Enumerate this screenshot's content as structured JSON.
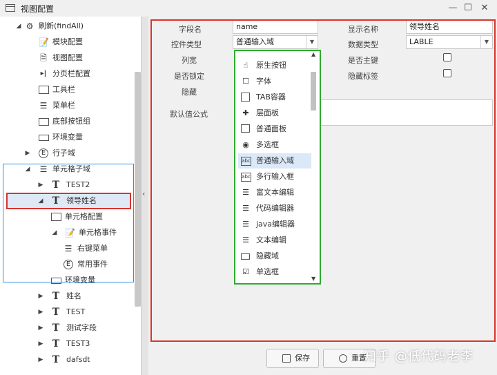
{
  "window": {
    "title": "视图配置",
    "controls": [
      "minimize",
      "maximize",
      "close"
    ]
  },
  "tree": {
    "items": [
      {
        "label": "刷新(findAll)",
        "icon": "gear-icon",
        "arrow": "▲"
      },
      {
        "label": "模块配置",
        "icon": "document-edit-icon"
      },
      {
        "label": "视图配置",
        "icon": "document-icon"
      },
      {
        "label": "分页栏配置",
        "icon": "pager-icon"
      },
      {
        "label": "工具栏",
        "icon": "toolbar-icon"
      },
      {
        "label": "菜单栏",
        "icon": "menu-icon"
      },
      {
        "label": "底部按钮组",
        "icon": "button-group-icon"
      },
      {
        "label": "环境变量",
        "icon": "env-icon"
      },
      {
        "label": "行子域",
        "icon": "event-icon",
        "arrow": "▶"
      },
      {
        "label": "单元格子域",
        "icon": "menu-icon",
        "arrow": "▲"
      },
      {
        "label": "TEST2",
        "icon": "text-field-icon",
        "arrow": "▶"
      },
      {
        "label": "领导姓名",
        "icon": "text-field-icon",
        "arrow": "◢"
      },
      {
        "label": "单元格配置",
        "icon": "window-icon"
      },
      {
        "label": "单元格事件",
        "icon": "document-edit-icon",
        "arrow": "◢"
      },
      {
        "label": "右键菜单",
        "icon": "menu-icon"
      },
      {
        "label": "常用事件",
        "icon": "event-icon"
      },
      {
        "label": "环境变量",
        "icon": "env-icon"
      },
      {
        "label": "姓名",
        "icon": "text-field-icon",
        "arrow": "▶"
      },
      {
        "label": "TEST",
        "icon": "text-field-icon",
        "arrow": "▶"
      },
      {
        "label": "测试字段",
        "icon": "text-field-icon",
        "arrow": "▶"
      },
      {
        "label": "TEST3",
        "icon": "text-field-icon",
        "arrow": "▶"
      },
      {
        "label": "dafsdt",
        "icon": "text-field-icon",
        "arrow": "▶"
      }
    ]
  },
  "form": {
    "field_name_label": "字段名",
    "field_name_value": "name",
    "display_name_label": "显示名称",
    "display_name_value": "领导姓名",
    "control_type_label": "控件类型",
    "control_type_value": "普通输入域",
    "data_type_label": "数据类型",
    "data_type_value": "LABLE",
    "column_width_label": "列宽",
    "is_pk_label": "是否主键",
    "is_locked_label": "是否锁定",
    "hide_label_label": "隐藏标签",
    "hidden_label": "隐藏",
    "default_formula_label": "默认值公式"
  },
  "dropdown": {
    "items": [
      {
        "label": "原生按钮",
        "icon": "hand-pointer-icon"
      },
      {
        "label": "字体",
        "icon": "checkbox-empty-icon"
      },
      {
        "label": "TAB容器",
        "icon": "tab-container-icon"
      },
      {
        "label": "层面板",
        "icon": "puzzle-icon"
      },
      {
        "label": "普通面板",
        "icon": "panel-icon"
      },
      {
        "label": "多选框",
        "icon": "radio-icon"
      },
      {
        "label": "普通输入域",
        "icon": "abc-icon",
        "selected": true
      },
      {
        "label": "多行输入框",
        "icon": "abc-icon"
      },
      {
        "label": "富文本编辑",
        "icon": "rich-text-icon"
      },
      {
        "label": "代码编辑器",
        "icon": "rich-text-icon"
      },
      {
        "label": "java编辑器",
        "icon": "rich-text-icon"
      },
      {
        "label": "文本编辑",
        "icon": "rich-text-icon"
      },
      {
        "label": "隐藏域",
        "icon": "hidden-field-icon"
      },
      {
        "label": "单选框",
        "icon": "checkbox-checked-icon"
      }
    ]
  },
  "buttons": {
    "save": "保存",
    "reset": "重置"
  },
  "watermark": "知乎 @低代码老李",
  "colors": {
    "highlight_red": "#d9342b",
    "highlight_blue": "#2f8de0",
    "highlight_green": "#2daa2d",
    "selection": "#dbe8f7"
  }
}
